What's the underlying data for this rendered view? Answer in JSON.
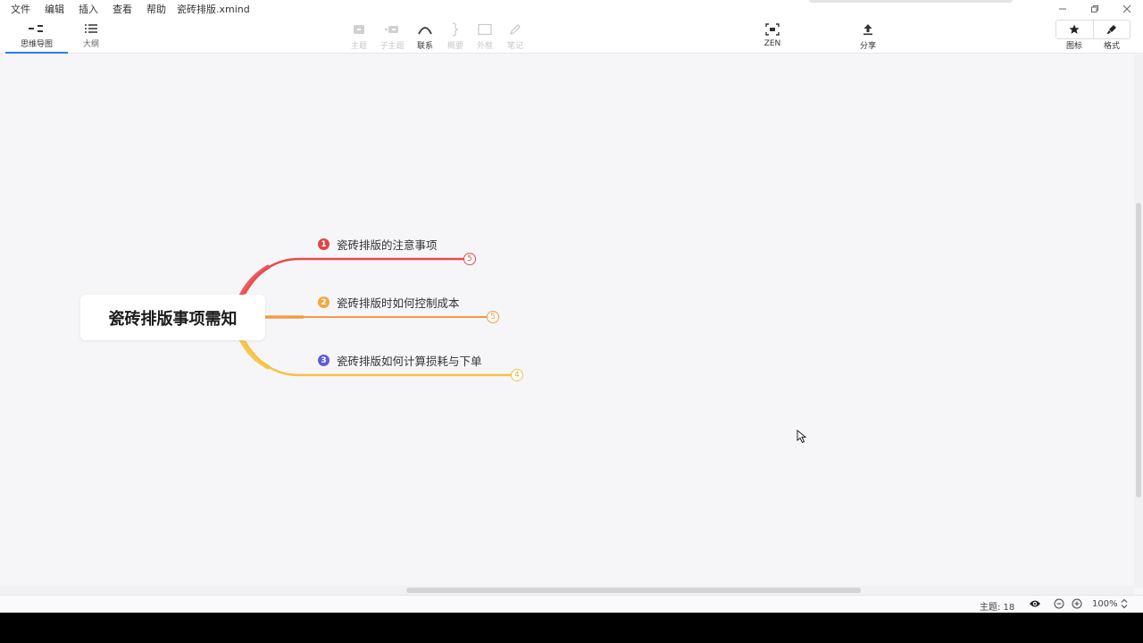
{
  "menu": [
    "文件",
    "编辑",
    "插入",
    "查看",
    "帮助"
  ],
  "file_title": "瓷砖排版.xmind",
  "view_tabs": [
    {
      "label": "思维导图",
      "active": true
    },
    {
      "label": "大纲",
      "active": false
    }
  ],
  "toolbar": {
    "topic": "主题",
    "subtopic": "子主题",
    "relationship": "联系",
    "summary": "概要",
    "boundary": "外框",
    "note": "笔记",
    "zen": "ZEN",
    "share": "分享"
  },
  "right_panel": {
    "icons": "图标",
    "format": "格式"
  },
  "central_topic": "瓷砖排版事项需知",
  "branches": [
    {
      "number": "1",
      "label": "瓷砖排版的注意事项",
      "collapsed_count": "5",
      "color": "#e04545"
    },
    {
      "number": "2",
      "label": "瓷砖排版时如何控制成本",
      "collapsed_count": "5",
      "color": "#f2a93b"
    },
    {
      "number": "3",
      "label": "瓷砖排版如何计算损耗与下单",
      "collapsed_count": "4",
      "color": "#5b5fd8"
    }
  ],
  "branch_line_colors": [
    "#e84b4b",
    "#f49a45",
    "#f5c242"
  ],
  "status": {
    "topic_count": "主题: 18",
    "zoom": "100%"
  }
}
